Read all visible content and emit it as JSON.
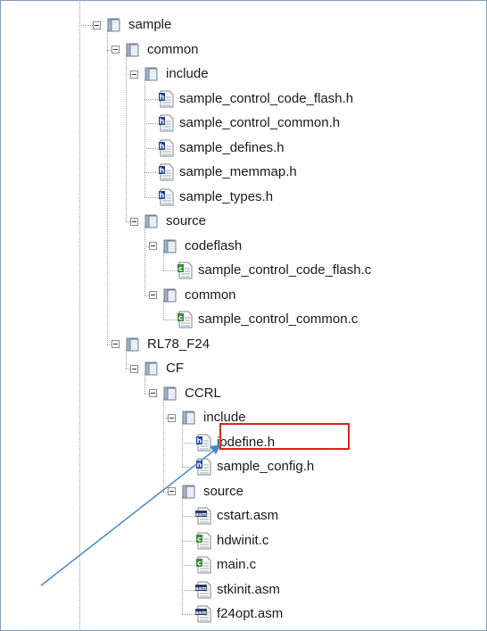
{
  "tree": [
    {
      "label": "sample",
      "kind": "folder",
      "level": 0
    },
    {
      "label": "common",
      "kind": "folder",
      "level": 1
    },
    {
      "label": "include",
      "kind": "folder",
      "level": 2
    },
    {
      "label": "sample_control_code_flash.h",
      "kind": "h",
      "level": 3
    },
    {
      "label": "sample_control_common.h",
      "kind": "h",
      "level": 3
    },
    {
      "label": "sample_defines.h",
      "kind": "h",
      "level": 3
    },
    {
      "label": "sample_memmap.h",
      "kind": "h",
      "level": 3
    },
    {
      "label": "sample_types.h",
      "kind": "h",
      "level": 3
    },
    {
      "label": "source",
      "kind": "folder",
      "level": 2
    },
    {
      "label": "codeflash",
      "kind": "folder",
      "level": 3
    },
    {
      "label": "sample_control_code_flash.c",
      "kind": "c",
      "level": 4
    },
    {
      "label": "common",
      "kind": "folder",
      "level": 3
    },
    {
      "label": "sample_control_common.c",
      "kind": "c",
      "level": 4
    },
    {
      "label": "RL78_F24",
      "kind": "folder",
      "level": 1
    },
    {
      "label": "CF",
      "kind": "folder",
      "level": 2
    },
    {
      "label": "CCRL",
      "kind": "folder",
      "level": 3
    },
    {
      "label": "include",
      "kind": "folder",
      "level": 4
    },
    {
      "label": "iodefine.h",
      "kind": "h",
      "level": 5
    },
    {
      "label": "sample_config.h",
      "kind": "h",
      "level": 5
    },
    {
      "label": "source",
      "kind": "folder",
      "level": 4
    },
    {
      "label": "cstart.asm",
      "kind": "asm",
      "level": 5
    },
    {
      "label": "hdwinit.c",
      "kind": "c",
      "level": 5
    },
    {
      "label": "main.c",
      "kind": "c",
      "level": 5
    },
    {
      "label": "stkinit.asm",
      "kind": "asm",
      "level": 5
    },
    {
      "label": "f24opt.asm",
      "kind": "asm",
      "level": 5
    }
  ],
  "highlight": {
    "label": "iodefine.h",
    "border_color": "#e02020"
  },
  "annotation": {
    "arrow_color": "#4a86c5"
  },
  "icons": {
    "folder": "folder-icon",
    "h": "header-file-icon",
    "c": "c-source-file-icon",
    "asm": "asm-file-icon"
  },
  "colors": {
    "folder": "#c9d6e3",
    "h_badge": "#1f3f9e",
    "c_badge": "#3a8a3a"
  }
}
